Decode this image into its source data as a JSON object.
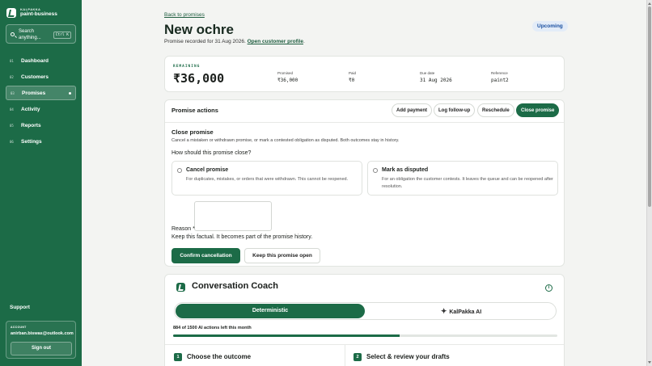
{
  "brand": {
    "kicker": "KALPAKKA",
    "name": "paint-business"
  },
  "search": {
    "label": "Search anything...",
    "shortcut": "Ctrl K"
  },
  "nav": {
    "items": [
      {
        "num": "01",
        "label": "Dashboard"
      },
      {
        "num": "02",
        "label": "Customers"
      },
      {
        "num": "03",
        "label": "Promises"
      },
      {
        "num": "04",
        "label": "Activity"
      },
      {
        "num": "05",
        "label": "Reports"
      },
      {
        "num": "06",
        "label": "Settings"
      }
    ],
    "active": "Promises"
  },
  "support_label": "Support",
  "account": {
    "kicker": "ACCOUNT",
    "email": "anirban.biswas@outlook.com",
    "signout_label": "Sign out"
  },
  "page": {
    "back_label": "Back to promises",
    "title": "New ochre",
    "subtitle_prefix": "Promise recorded for 31 Aug 2026.",
    "profile_link": "Open customer profile",
    "subtitle_suffix": ".",
    "status_badge": "Upcoming"
  },
  "summary": {
    "remaining_kicker": "REMAINING",
    "remaining_value": "₹36,000",
    "stats": [
      {
        "label": "Promised",
        "value": "₹36,000"
      },
      {
        "label": "Paid",
        "value": "₹0"
      },
      {
        "label": "Due date",
        "value": "31 Aug 2026"
      },
      {
        "label": "Reference",
        "value": "paint2"
      }
    ]
  },
  "actions": {
    "title": "Promise actions",
    "buttons": [
      "Add payment",
      "Log follow-up",
      "Reschedule",
      "Close promise"
    ],
    "close_title": "Close promise",
    "close_desc": "Cancel a mistaken or withdrawn promise, or mark a contested obligation as disputed. Both outcomes stay in history.",
    "question": "How should this promise close?",
    "options": [
      {
        "title": "Cancel promise",
        "desc": "For duplicates, mistakes, or orders that were withdrawn. This cannot be reopened."
      },
      {
        "title": "Mark as disputed",
        "desc": "For an obligation the customer contests. It leaves the queue and can be reopened after resolution."
      }
    ],
    "reason_label": "Reason *",
    "reason_hint": "Keep this factual. It becomes part of the promise history.",
    "confirm_label": "Confirm cancellation",
    "keep_open_label": "Keep this promise open"
  },
  "coach": {
    "title": "Conversation Coach",
    "info_icon": "i",
    "modes": [
      "Deterministic",
      "KalPakka AI"
    ],
    "usage_text": "884 of 1500 AI actions left this month",
    "usage_fraction": 0.5893,
    "steps": [
      {
        "num": "1",
        "label": "Choose the outcome"
      },
      {
        "num": "2",
        "label": "Select & review your drafts"
      }
    ]
  },
  "colors": {
    "brand": "#1c6b47",
    "status_upcoming": "#1a4fa0"
  }
}
